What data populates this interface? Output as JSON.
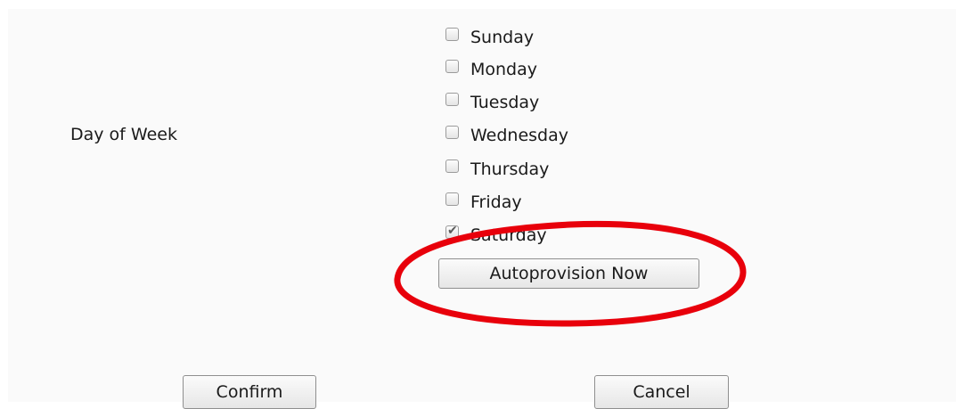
{
  "form": {
    "day_of_week_label": "Day of Week",
    "days": [
      {
        "label": "Sunday",
        "checked": false
      },
      {
        "label": "Monday",
        "checked": false
      },
      {
        "label": "Tuesday",
        "checked": false
      },
      {
        "label": "Wednesday",
        "checked": false
      },
      {
        "label": "Thursday",
        "checked": false
      },
      {
        "label": "Friday",
        "checked": false
      },
      {
        "label": "Saturday",
        "checked": true
      }
    ],
    "autoprovision_label": "Autoprovision Now"
  },
  "actions": {
    "confirm_label": "Confirm",
    "cancel_label": "Cancel"
  },
  "annotation": {
    "color": "#e8000b",
    "shape": "ellipse"
  }
}
